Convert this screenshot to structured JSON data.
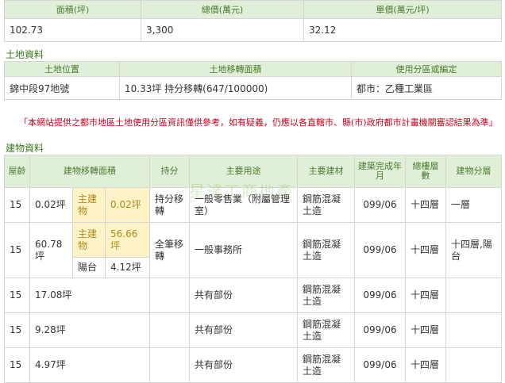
{
  "price": {
    "headers": [
      "面積(坪)",
      "總價(萬元)",
      "單價(萬元/坪)"
    ],
    "values": [
      "102.73",
      "3,300",
      "32.12"
    ]
  },
  "land": {
    "title": "土地資料",
    "headers": [
      "土地位置",
      "土地移轉面積",
      "使用分區或編定"
    ],
    "values": [
      "錦中段97地號",
      "10.33坪 持分移轉(647/100000)",
      "都市：乙種工業區"
    ]
  },
  "notice": "「本網站提供之都市地區土地使用分區資訊僅供參考，如有疑義，仍應以各直轄市、縣(市)政府都市計畫機關審認結果為準」",
  "building": {
    "title": "建物資料",
    "headers": [
      "屋齡",
      "建物移轉面積",
      "持分",
      "主要用途",
      "主要建材",
      "建築完成年月",
      "總樓層數",
      "建物分層"
    ],
    "rows": [
      {
        "age": "15",
        "area": "0.02坪",
        "sub_label": "主建物",
        "sub_value": "0.02坪",
        "share": "持分移轉",
        "use": "一般零售業（附屬管理室）",
        "material": "鋼筋混凝土造",
        "date": "099/06",
        "floors": "十四層",
        "layer": "一層"
      },
      {
        "age": "15",
        "area": "60.78坪",
        "sub_label": "主建物",
        "sub_value": "56.66坪",
        "sub2_label": "陽台",
        "sub2_value": "4.12坪",
        "share": "全筆移轉",
        "use": "一般事務所",
        "material": "鋼筋混凝土造",
        "date": "099/06",
        "floors": "十四層",
        "layer": "十四層,陽台"
      },
      {
        "age": "15",
        "area": "17.08坪",
        "use": "共有部份",
        "material": "鋼筋混凝土造",
        "date": "099/06",
        "floors": "十四層"
      },
      {
        "age": "15",
        "area": "9.28坪",
        "use": "共有部份",
        "material": "鋼筋混凝土造",
        "date": "099/06",
        "floors": "十四層"
      },
      {
        "age": "15",
        "area": "4.97坪",
        "use": "共有部份",
        "material": "鋼筋混凝土造",
        "date": "099/06",
        "floors": "十四層"
      }
    ]
  },
  "watermark": "星達工商地產"
}
